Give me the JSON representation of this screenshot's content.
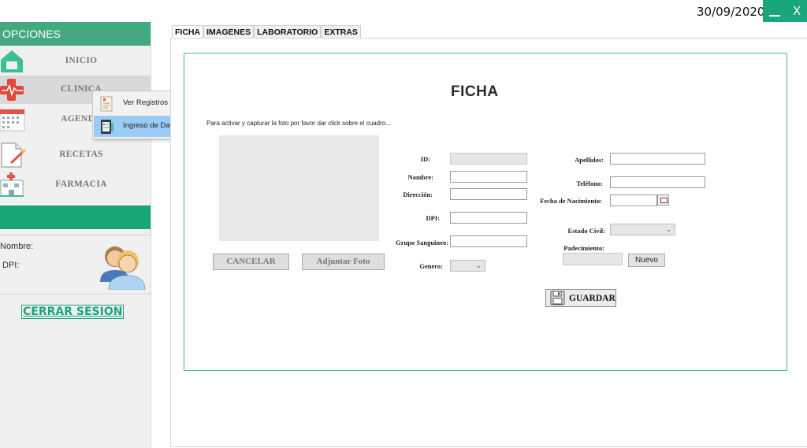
{
  "header": {
    "date": "30/09/2020",
    "minimize_label": "",
    "close_label": "X"
  },
  "sidebar": {
    "title": "OPCIONES",
    "items": [
      {
        "label": "INICIO",
        "icon": "home-icon"
      },
      {
        "label": "CLINICA",
        "icon": "medical-cross-icon"
      },
      {
        "label": "AGENDA",
        "icon": "calendar-icon"
      },
      {
        "label": "RECETAS",
        "icon": "prescription-icon"
      },
      {
        "label": "FARMACIA",
        "icon": "pharmacy-icon"
      }
    ],
    "user": {
      "name_label": "Nombre:",
      "dpi_label": "DPI:"
    },
    "logout_label": "CERRAR SESION"
  },
  "context_menu": {
    "items": [
      {
        "label": "Ver Registros",
        "icon": "records-icon"
      },
      {
        "label": "Ingreso de Datos",
        "icon": "data-entry-icon"
      }
    ]
  },
  "tabs": [
    "FICHA",
    "IMAGENES",
    "LABORATORIO",
    "EXTRAS"
  ],
  "form": {
    "title": "FICHA",
    "photo_hint": "Para activar y capturar la foto por favor dar click sobre el cuadro...",
    "cancel_label": "CANCELAR",
    "attach_label": "Adjuntar Foto",
    "labels": {
      "id": "ID:",
      "nombre": "Nombre:",
      "direccion": "Dirección:",
      "dpi": "DPI:",
      "grupo": "Grupo Sanguineo:",
      "genero": "Genero:",
      "apellidos": "Apellidos:",
      "telefono": "Teléfono:",
      "fecha": "Fecha de Nacimiento:",
      "estado": "Estado Civil:",
      "padecimiento": "Padecimiento:"
    },
    "nuevo_label": "Nuevo",
    "save_label": "GUARDAR",
    "colors": {
      "accent": "#1aa67d",
      "header_green": "#42a980",
      "frame": "#4aba8e"
    }
  }
}
